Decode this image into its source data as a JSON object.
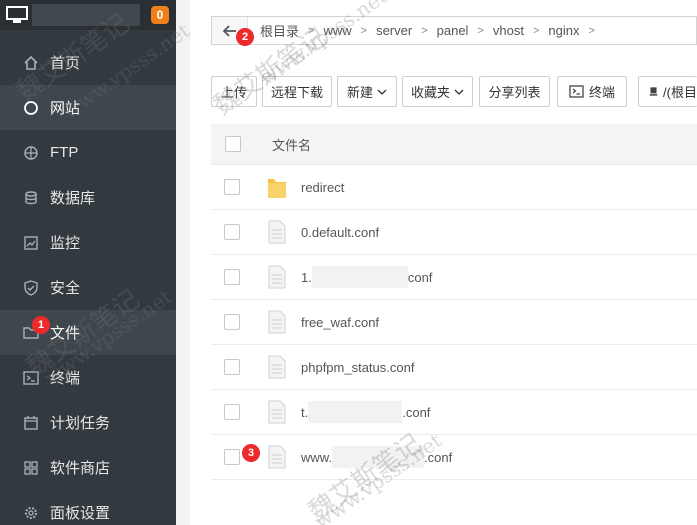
{
  "sidebar": {
    "badge": "0",
    "items": [
      {
        "label": "首页",
        "icon": "home-icon"
      },
      {
        "label": "网站",
        "icon": "globe-icon"
      },
      {
        "label": "FTP",
        "icon": "ftp-icon"
      },
      {
        "label": "数据库",
        "icon": "database-icon"
      },
      {
        "label": "监控",
        "icon": "chart-icon"
      },
      {
        "label": "安全",
        "icon": "shield-icon"
      },
      {
        "label": "文件",
        "icon": "folder-icon"
      },
      {
        "label": "终端",
        "icon": "terminal-icon"
      },
      {
        "label": "计划任务",
        "icon": "calendar-icon"
      },
      {
        "label": "软件商店",
        "icon": "grid-icon"
      },
      {
        "label": "面板设置",
        "icon": "gear-icon"
      }
    ]
  },
  "breadcrumb": [
    "根目录",
    "www",
    "server",
    "panel",
    "vhost",
    "nginx"
  ],
  "toolbar": {
    "upload": "上传",
    "remote_download": "远程下载",
    "new": "新建",
    "favorites": "收藏夹",
    "share_list": "分享列表",
    "terminal": "终端",
    "root_path": "/(根目"
  },
  "table": {
    "header": "文件名",
    "rows": [
      {
        "type": "folder",
        "prefix": "redirect",
        "suffix": ""
      },
      {
        "type": "file",
        "prefix": "0.default.conf",
        "suffix": ""
      },
      {
        "type": "file",
        "prefix": "1.",
        "suffix": "conf"
      },
      {
        "type": "file",
        "prefix": "free_waf.conf",
        "suffix": ""
      },
      {
        "type": "file",
        "prefix": "phpfpm_status.conf",
        "suffix": ""
      },
      {
        "type": "file",
        "prefix": "t.",
        "suffix": ".conf"
      },
      {
        "type": "file",
        "prefix": "www.",
        "suffix": ".conf"
      }
    ]
  },
  "markers": [
    "1",
    "2",
    "3"
  ],
  "watermark": {
    "cn": "魏艾斯笔记",
    "url": "www.vpsss.net"
  },
  "colors": {
    "sidebar": "#333a3f",
    "badge": "#ef7f1a",
    "marker": "#ec2a2a",
    "folder": "#f5c243"
  }
}
